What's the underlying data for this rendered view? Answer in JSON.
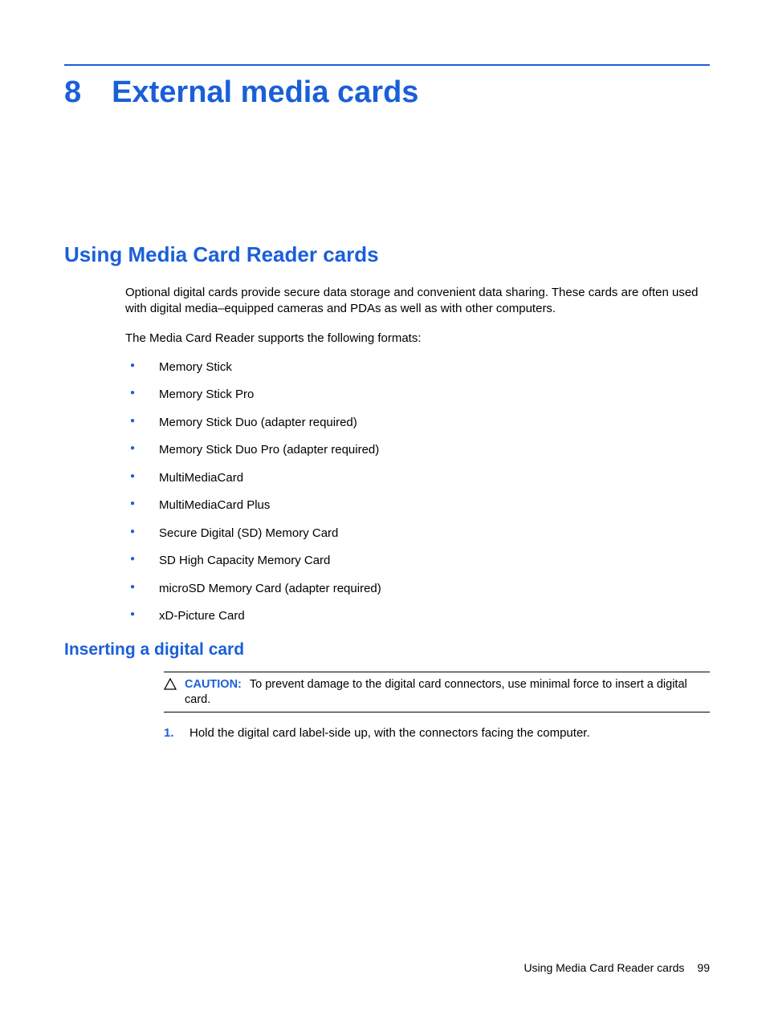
{
  "chapter": {
    "number": "8",
    "title": "External media cards"
  },
  "section1": {
    "heading": "Using Media Card Reader cards",
    "para1": "Optional digital cards provide secure data storage and convenient data sharing. These cards are often used with digital media–equipped cameras and PDAs as well as with other computers.",
    "para2": "The Media Card Reader supports the following formats:",
    "bullets": [
      "Memory Stick",
      "Memory Stick Pro",
      "Memory Stick Duo (adapter required)",
      "Memory Stick Duo Pro (adapter required)",
      "MultiMediaCard",
      "MultiMediaCard Plus",
      "Secure Digital (SD) Memory Card",
      "SD High Capacity Memory Card",
      "microSD Memory Card (adapter required)",
      "xD-Picture Card"
    ]
  },
  "subsection1": {
    "heading": "Inserting a digital card",
    "caution_label": "CAUTION:",
    "caution_text": "To prevent damage to the digital card connectors, use minimal force to insert a digital card.",
    "steps": [
      {
        "num": "1.",
        "text": "Hold the digital card label-side up, with the connectors facing the computer."
      }
    ]
  },
  "footer": {
    "text": "Using Media Card Reader cards",
    "page": "99"
  }
}
